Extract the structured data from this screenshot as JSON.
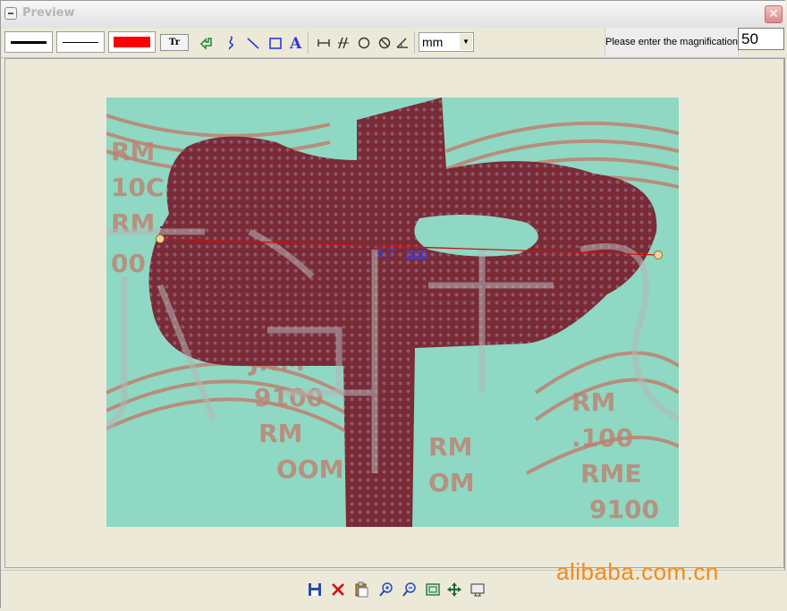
{
  "window": {
    "title": "Preview"
  },
  "toolbar": {
    "unit": "mm",
    "text_tool": "Tr",
    "magnification_label": "Please enter the magnification",
    "magnification_value": "50",
    "line_color": "#ff0000"
  },
  "measurement": {
    "value": "6.7",
    "unit": "mm"
  },
  "watermark": {
    "text": "alibaba.com.cn"
  },
  "colors": {
    "line": "#cc1111",
    "handle": "#f1d49a",
    "label": "#3a46ff",
    "accent": "#f28c1e"
  }
}
